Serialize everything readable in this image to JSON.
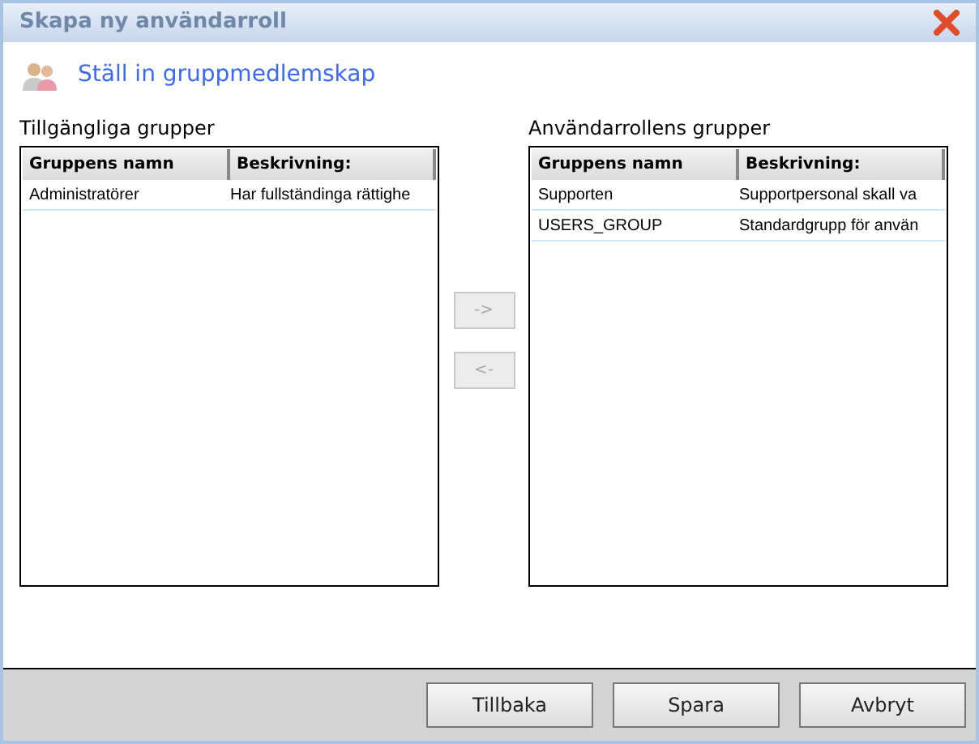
{
  "window": {
    "title": "Skapa ny användarroll"
  },
  "heading": "Ställ in gruppmedlemskap",
  "available": {
    "label": "Tillgängliga grupper",
    "columns": [
      "Gruppens namn",
      "Beskrivning:"
    ],
    "rows": [
      {
        "name": "Administratörer",
        "description": "Har fullständinga rättighe"
      }
    ]
  },
  "assigned": {
    "label": "Användarrollens grupper",
    "columns": [
      "Gruppens namn",
      "Beskrivning:"
    ],
    "rows": [
      {
        "name": "Supporten",
        "description": "Supportpersonal skall va"
      },
      {
        "name": "USERS_GROUP",
        "description": "Standardgrupp för använ"
      }
    ]
  },
  "move_buttons": [
    {
      "label": "->",
      "disabled": true
    },
    {
      "label": "<-",
      "disabled": true
    }
  ],
  "buttons": [
    "Tillbaka",
    "Spara",
    "Avbryt"
  ]
}
